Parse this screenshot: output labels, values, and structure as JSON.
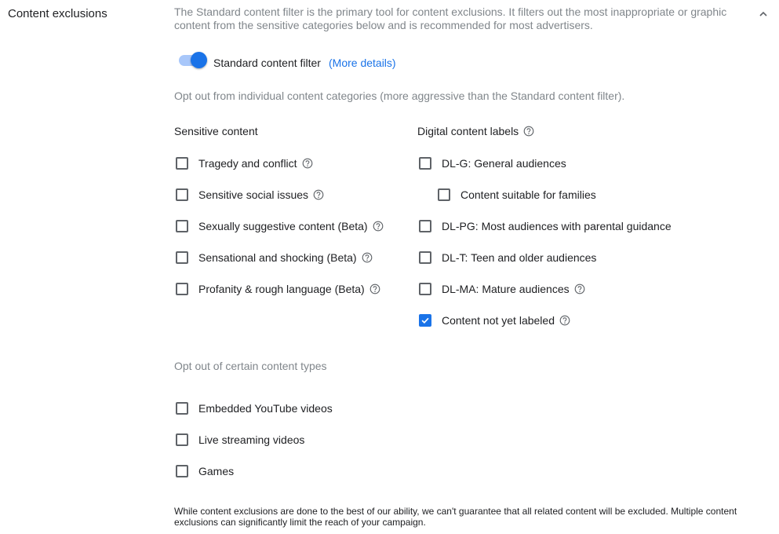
{
  "section": {
    "title": "Content exclusions"
  },
  "intro": "The Standard content filter is the primary tool for content exclusions. It filters out the most inappropriate or graphic content from the sensitive categories below and is recommended for most advertisers.",
  "standard_filter": {
    "label": "Standard content filter",
    "link": "(More details)",
    "enabled": true
  },
  "opt_out_categories": "Opt out from individual content categories (more aggressive than the Standard content filter).",
  "sensitive": {
    "heading": "Sensitive content",
    "items": [
      {
        "label": "Tragedy and conflict",
        "checked": false,
        "help": true
      },
      {
        "label": "Sensitive social issues",
        "checked": false,
        "help": true
      },
      {
        "label": "Sexually suggestive content (Beta)",
        "checked": false,
        "help": true
      },
      {
        "label": "Sensational and shocking (Beta)",
        "checked": false,
        "help": true
      },
      {
        "label": "Profanity & rough language (Beta)",
        "checked": false,
        "help": true
      }
    ]
  },
  "digital": {
    "heading": "Digital content labels",
    "items": [
      {
        "label": "DL-G: General audiences",
        "checked": false,
        "help": false
      },
      {
        "label": "Content suitable for families",
        "checked": false,
        "help": false,
        "indent": true
      },
      {
        "label": "DL-PG: Most audiences with parental guidance",
        "checked": false,
        "help": false
      },
      {
        "label": "DL-T: Teen and older audiences",
        "checked": false,
        "help": false
      },
      {
        "label": "DL-MA: Mature audiences",
        "checked": false,
        "help": true
      },
      {
        "label": "Content not yet labeled",
        "checked": true,
        "help": true
      }
    ]
  },
  "types": {
    "heading": "Opt out of certain content types",
    "items": [
      {
        "label": "Embedded YouTube videos",
        "checked": false
      },
      {
        "label": "Live streaming videos",
        "checked": false
      },
      {
        "label": "Games",
        "checked": false
      }
    ]
  },
  "footer": "While content exclusions are done to the best of our ability, we can't guarantee that all related content will be excluded. Multiple content exclusions can significantly limit the reach of your campaign.",
  "colors": {
    "accent": "#1a73e8",
    "muted_text": "#80868b",
    "toggle_track": "#a8c7fa"
  },
  "icons": {
    "help": "help-outline-icon",
    "collapse": "chevron-up-icon",
    "check": "check-icon"
  }
}
